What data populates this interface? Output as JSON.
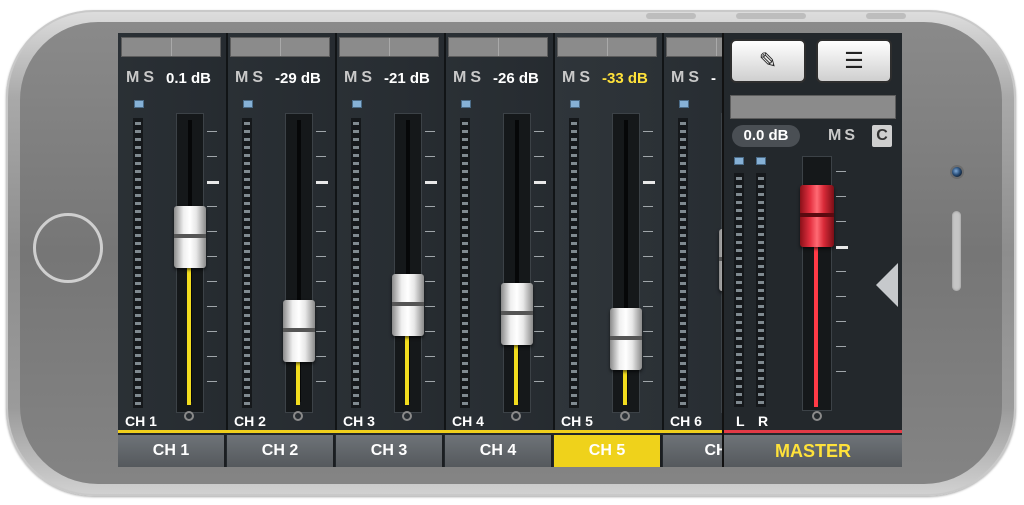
{
  "channels": [
    {
      "ms_m": "M",
      "ms_s": "S",
      "db": "0.1 dB",
      "label": "CH 1",
      "tab": "CH 1",
      "level": 0.58,
      "highlight": false
    },
    {
      "ms_m": "M",
      "ms_s": "S",
      "db": "-29 dB",
      "label": "CH 2",
      "tab": "CH 2",
      "level": 0.25,
      "highlight": false
    },
    {
      "ms_m": "M",
      "ms_s": "S",
      "db": "-21 dB",
      "label": "CH 3",
      "tab": "CH 3",
      "level": 0.34,
      "highlight": false
    },
    {
      "ms_m": "M",
      "ms_s": "S",
      "db": "-26 dB",
      "label": "CH 4",
      "tab": "CH 4",
      "level": 0.31,
      "highlight": false
    },
    {
      "ms_m": "M",
      "ms_s": "S",
      "db": "-33 dB",
      "label": "CH 5",
      "tab": "CH 5",
      "level": 0.22,
      "highlight": true
    },
    {
      "ms_m": "M",
      "ms_s": "S",
      "db": "-",
      "label": "CH 6",
      "tab": "CH",
      "level": 0.5,
      "highlight": false
    }
  ],
  "master": {
    "db": "0.0 dB",
    "ms_m": "M",
    "ms_s": "S",
    "c_label": "C",
    "left_label": "L",
    "right_label": "R",
    "tab": "MASTER",
    "level": 0.78,
    "edit_icon": "edit-icon",
    "menu_icon": "menu-icon",
    "fill_color": "#ff3a46"
  },
  "colors": {
    "accent": "#f0cf1c",
    "selected_tab": "#efd21b",
    "master_accent": "#e23a46"
  }
}
